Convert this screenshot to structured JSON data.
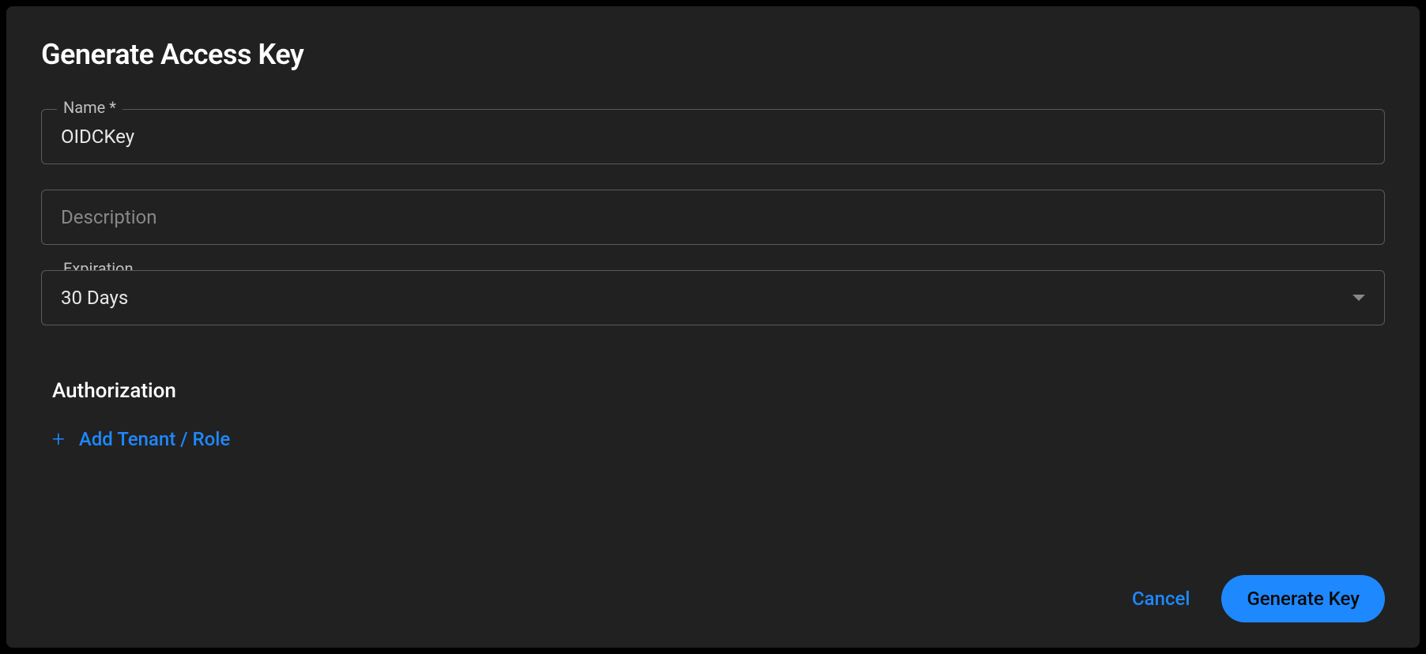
{
  "modal": {
    "title": "Generate Access Key",
    "fields": {
      "name": {
        "label": "Name *",
        "value": "OIDCKey"
      },
      "description": {
        "placeholder": "Description",
        "value": ""
      },
      "expiration": {
        "label": "Expiration",
        "value": "30 Days"
      }
    },
    "authorization": {
      "title": "Authorization",
      "addButton": "Add Tenant / Role"
    },
    "buttons": {
      "cancel": "Cancel",
      "generate": "Generate Key"
    }
  }
}
